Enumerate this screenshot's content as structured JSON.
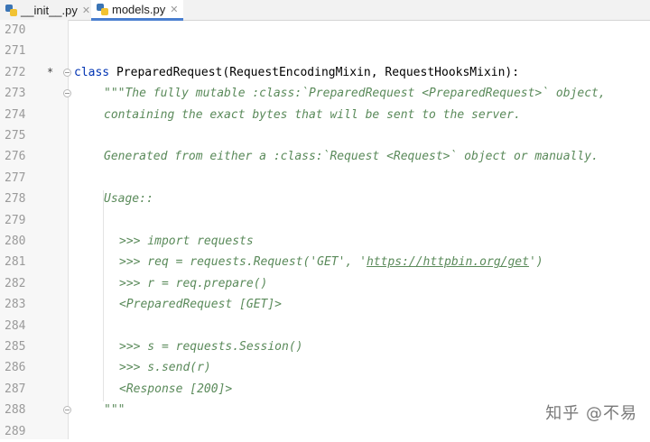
{
  "tabs": [
    {
      "label": "__init__.py",
      "close": "✕",
      "active": false
    },
    {
      "label": "models.py",
      "close": "✕",
      "active": true
    }
  ],
  "lines": [
    {
      "num": "270",
      "text": ""
    },
    {
      "num": "271",
      "text": ""
    },
    {
      "num": "272",
      "marker": "*",
      "kw": "class",
      "text": " PreparedRequest(RequestEncodingMixin, RequestHooksMixin):"
    },
    {
      "num": "273",
      "text": "\"\"\"The fully mutable :class:`PreparedRequest <PreparedRequest>` object,"
    },
    {
      "num": "274",
      "text": "containing the exact bytes that will be sent to the server."
    },
    {
      "num": "275",
      "text": ""
    },
    {
      "num": "276",
      "text": "Generated from either a :class:`Request <Request>` object or manually."
    },
    {
      "num": "277",
      "text": ""
    },
    {
      "num": "278",
      "text": "Usage::"
    },
    {
      "num": "279",
      "text": ""
    },
    {
      "num": "280",
      "text": ">>> import requests"
    },
    {
      "num": "281",
      "pre": ">>> req = requests.Request('GET', '",
      "link": "https://httpbin.org/get",
      "post": "')"
    },
    {
      "num": "282",
      "text": ">>> r = req.prepare()"
    },
    {
      "num": "283",
      "text": "<PreparedRequest [GET]>"
    },
    {
      "num": "284",
      "text": ""
    },
    {
      "num": "285",
      "text": ">>> s = requests.Session()"
    },
    {
      "num": "286",
      "text": ">>> s.send(r)"
    },
    {
      "num": "287",
      "text": "<Response [200]>"
    },
    {
      "num": "288",
      "text": "\"\"\""
    },
    {
      "num": "289",
      "text": ""
    }
  ],
  "watermark": "知乎 @不易"
}
